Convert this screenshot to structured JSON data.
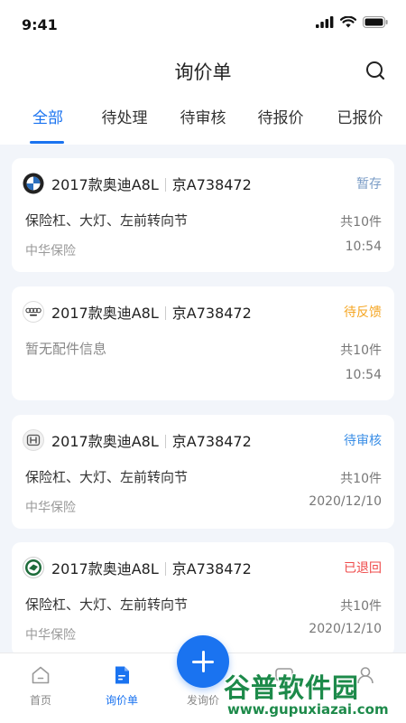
{
  "status_bar": {
    "time": "9:41"
  },
  "header": {
    "title": "询价单"
  },
  "tabs": [
    {
      "label": "全部",
      "active": true
    },
    {
      "label": "待处理",
      "active": false
    },
    {
      "label": "待审核",
      "active": false
    },
    {
      "label": "待报价",
      "active": false
    },
    {
      "label": "已报价",
      "active": false
    }
  ],
  "cards": [
    {
      "brand_icon": "bmw-logo-icon",
      "model": "2017款奥迪A8L",
      "plate": "京A738472",
      "status": "暂存",
      "status_color": "#7a9cc6",
      "parts": "保险杠、大灯、左前转向节",
      "count": "共10件",
      "insurer": "中华保险",
      "time": "10:54"
    },
    {
      "brand_icon": "audi-logo-icon",
      "model": "2017款奥迪A8L",
      "plate": "京A738472",
      "status": "待反馈",
      "status_color": "#f5a623",
      "parts": "暂无配件信息",
      "count": "共10件",
      "insurer": "",
      "time": "10:54"
    },
    {
      "brand_icon": "honda-logo-icon",
      "model": "2017款奥迪A8L",
      "plate": "京A738472",
      "status": "待审核",
      "status_color": "#3a8ee6",
      "parts": "保险杠、大灯、左前转向节",
      "count": "共10件",
      "insurer": "中华保险",
      "time": "2020/12/10"
    },
    {
      "brand_icon": "skoda-logo-icon",
      "model": "2017款奥迪A8L",
      "plate": "京A738472",
      "status": "已退回",
      "status_color": "#ef4a4a",
      "parts": "保险杠、大灯、左前转向节",
      "count": "共10件",
      "insurer": "中华保险",
      "time": "2020/12/10"
    }
  ],
  "tabbar": {
    "home": "首页",
    "inquiry": "询价单",
    "publish": "发询价",
    "mine": "我的"
  },
  "watermark": {
    "text": "谷普软件园",
    "url": "www.gupuxiazai.com"
  },
  "colors": {
    "accent": "#1a73f0",
    "background": "#f2f5fa"
  }
}
